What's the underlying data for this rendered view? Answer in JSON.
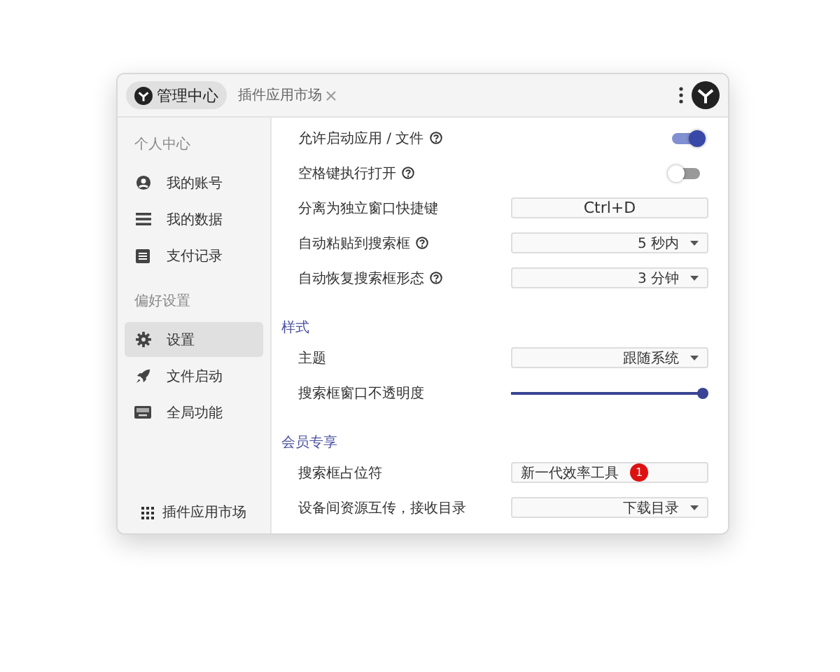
{
  "tabs": [
    {
      "label": "管理中心",
      "selected": true
    },
    {
      "label": "插件应用市场",
      "selected": false
    }
  ],
  "sidebar": {
    "groups": [
      {
        "label": "个人中心",
        "items": [
          {
            "label": "我的账号",
            "selected": false
          },
          {
            "label": "我的数据",
            "selected": false
          },
          {
            "label": "支付记录",
            "selected": false
          }
        ]
      },
      {
        "label": "偏好设置",
        "items": [
          {
            "label": "设置",
            "selected": true
          },
          {
            "label": "文件启动",
            "selected": false
          },
          {
            "label": "全局功能",
            "selected": false
          }
        ]
      }
    ],
    "footer": {
      "label": "插件应用市场"
    }
  },
  "sections": [
    {
      "rows": [
        {
          "label": "允许启动应用 / 文件",
          "help": true,
          "kind": "toggle",
          "on": true
        },
        {
          "label": "空格键执行打开",
          "help": true,
          "kind": "toggle",
          "on": false
        },
        {
          "label": "分离为独立窗口快捷键",
          "help": false,
          "kind": "shortcut",
          "value": "Ctrl+D"
        },
        {
          "label": "自动粘贴到搜索框",
          "help": true,
          "kind": "select",
          "value": "5 秒内"
        },
        {
          "label": "自动恢复搜索框形态",
          "help": true,
          "kind": "select",
          "value": "3 分钟"
        }
      ]
    },
    {
      "heading": "样式",
      "rows": [
        {
          "label": "主题",
          "help": false,
          "kind": "select",
          "value": "跟随系统"
        },
        {
          "label": "搜索框窗口不透明度",
          "help": false,
          "kind": "slider",
          "level": 1
        }
      ]
    },
    {
      "heading": "会员专享",
      "rows": [
        {
          "label": "搜索框占位符",
          "help": false,
          "kind": "text",
          "value": "新一代效率工具",
          "badge": "1"
        },
        {
          "label": "设备间资源互传，接收目录",
          "help": false,
          "kind": "select",
          "value": "下载目录"
        }
      ]
    }
  ]
}
